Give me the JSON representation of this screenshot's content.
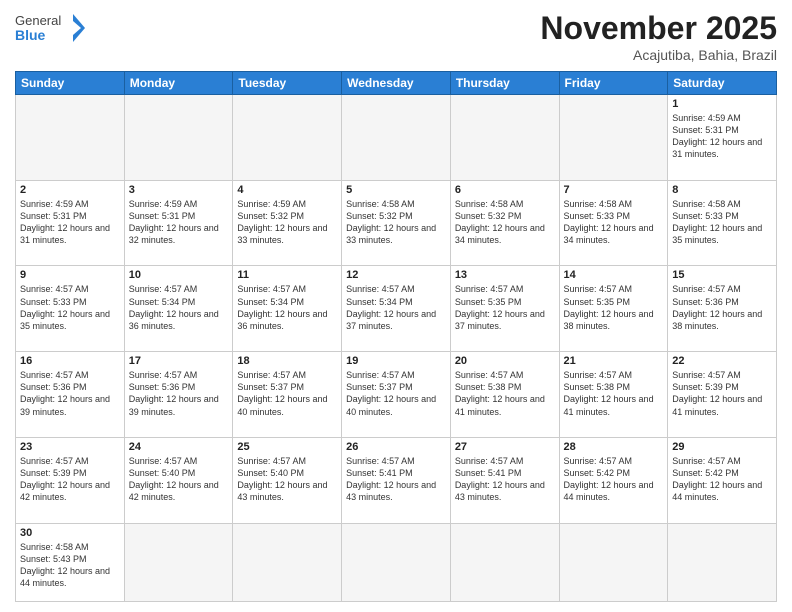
{
  "header": {
    "logo_general": "General",
    "logo_blue": "Blue",
    "month_title": "November 2025",
    "location": "Acajutiba, Bahia, Brazil"
  },
  "weekdays": [
    "Sunday",
    "Monday",
    "Tuesday",
    "Wednesday",
    "Thursday",
    "Friday",
    "Saturday"
  ],
  "weeks": [
    [
      {
        "day": "",
        "info": ""
      },
      {
        "day": "",
        "info": ""
      },
      {
        "day": "",
        "info": ""
      },
      {
        "day": "",
        "info": ""
      },
      {
        "day": "",
        "info": ""
      },
      {
        "day": "",
        "info": ""
      },
      {
        "day": "1",
        "info": "Sunrise: 4:59 AM\nSunset: 5:31 PM\nDaylight: 12 hours\nand 31 minutes."
      }
    ],
    [
      {
        "day": "2",
        "info": "Sunrise: 4:59 AM\nSunset: 5:31 PM\nDaylight: 12 hours\nand 31 minutes."
      },
      {
        "day": "3",
        "info": "Sunrise: 4:59 AM\nSunset: 5:31 PM\nDaylight: 12 hours\nand 32 minutes."
      },
      {
        "day": "4",
        "info": "Sunrise: 4:59 AM\nSunset: 5:32 PM\nDaylight: 12 hours\nand 33 minutes."
      },
      {
        "day": "5",
        "info": "Sunrise: 4:58 AM\nSunset: 5:32 PM\nDaylight: 12 hours\nand 33 minutes."
      },
      {
        "day": "6",
        "info": "Sunrise: 4:58 AM\nSunset: 5:32 PM\nDaylight: 12 hours\nand 34 minutes."
      },
      {
        "day": "7",
        "info": "Sunrise: 4:58 AM\nSunset: 5:33 PM\nDaylight: 12 hours\nand 34 minutes."
      },
      {
        "day": "8",
        "info": "Sunrise: 4:58 AM\nSunset: 5:33 PM\nDaylight: 12 hours\nand 35 minutes."
      }
    ],
    [
      {
        "day": "9",
        "info": "Sunrise: 4:57 AM\nSunset: 5:33 PM\nDaylight: 12 hours\nand 35 minutes."
      },
      {
        "day": "10",
        "info": "Sunrise: 4:57 AM\nSunset: 5:34 PM\nDaylight: 12 hours\nand 36 minutes."
      },
      {
        "day": "11",
        "info": "Sunrise: 4:57 AM\nSunset: 5:34 PM\nDaylight: 12 hours\nand 36 minutes."
      },
      {
        "day": "12",
        "info": "Sunrise: 4:57 AM\nSunset: 5:34 PM\nDaylight: 12 hours\nand 37 minutes."
      },
      {
        "day": "13",
        "info": "Sunrise: 4:57 AM\nSunset: 5:35 PM\nDaylight: 12 hours\nand 37 minutes."
      },
      {
        "day": "14",
        "info": "Sunrise: 4:57 AM\nSunset: 5:35 PM\nDaylight: 12 hours\nand 38 minutes."
      },
      {
        "day": "15",
        "info": "Sunrise: 4:57 AM\nSunset: 5:36 PM\nDaylight: 12 hours\nand 38 minutes."
      }
    ],
    [
      {
        "day": "16",
        "info": "Sunrise: 4:57 AM\nSunset: 5:36 PM\nDaylight: 12 hours\nand 39 minutes."
      },
      {
        "day": "17",
        "info": "Sunrise: 4:57 AM\nSunset: 5:36 PM\nDaylight: 12 hours\nand 39 minutes."
      },
      {
        "day": "18",
        "info": "Sunrise: 4:57 AM\nSunset: 5:37 PM\nDaylight: 12 hours\nand 40 minutes."
      },
      {
        "day": "19",
        "info": "Sunrise: 4:57 AM\nSunset: 5:37 PM\nDaylight: 12 hours\nand 40 minutes."
      },
      {
        "day": "20",
        "info": "Sunrise: 4:57 AM\nSunset: 5:38 PM\nDaylight: 12 hours\nand 41 minutes."
      },
      {
        "day": "21",
        "info": "Sunrise: 4:57 AM\nSunset: 5:38 PM\nDaylight: 12 hours\nand 41 minutes."
      },
      {
        "day": "22",
        "info": "Sunrise: 4:57 AM\nSunset: 5:39 PM\nDaylight: 12 hours\nand 41 minutes."
      }
    ],
    [
      {
        "day": "23",
        "info": "Sunrise: 4:57 AM\nSunset: 5:39 PM\nDaylight: 12 hours\nand 42 minutes."
      },
      {
        "day": "24",
        "info": "Sunrise: 4:57 AM\nSunset: 5:40 PM\nDaylight: 12 hours\nand 42 minutes."
      },
      {
        "day": "25",
        "info": "Sunrise: 4:57 AM\nSunset: 5:40 PM\nDaylight: 12 hours\nand 43 minutes."
      },
      {
        "day": "26",
        "info": "Sunrise: 4:57 AM\nSunset: 5:41 PM\nDaylight: 12 hours\nand 43 minutes."
      },
      {
        "day": "27",
        "info": "Sunrise: 4:57 AM\nSunset: 5:41 PM\nDaylight: 12 hours\nand 43 minutes."
      },
      {
        "day": "28",
        "info": "Sunrise: 4:57 AM\nSunset: 5:42 PM\nDaylight: 12 hours\nand 44 minutes."
      },
      {
        "day": "29",
        "info": "Sunrise: 4:57 AM\nSunset: 5:42 PM\nDaylight: 12 hours\nand 44 minutes."
      }
    ],
    [
      {
        "day": "30",
        "info": "Sunrise: 4:58 AM\nSunset: 5:43 PM\nDaylight: 12 hours\nand 44 minutes."
      },
      {
        "day": "",
        "info": ""
      },
      {
        "day": "",
        "info": ""
      },
      {
        "day": "",
        "info": ""
      },
      {
        "day": "",
        "info": ""
      },
      {
        "day": "",
        "info": ""
      },
      {
        "day": "",
        "info": ""
      }
    ]
  ]
}
